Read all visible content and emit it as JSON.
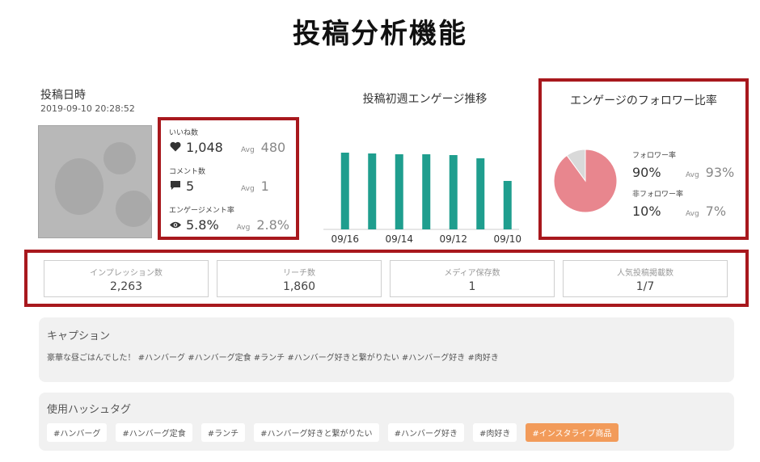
{
  "page": {
    "title": "投稿分析機能"
  },
  "post": {
    "date_label": "投稿日時",
    "date": "2019-09-10 20:28:52"
  },
  "stats": [
    {
      "label": "いいね数",
      "icon": "heart-icon",
      "value": "1,048",
      "avg_label": "Avg",
      "avg_value": "480"
    },
    {
      "label": "コメント数",
      "icon": "comment-icon",
      "value": "5",
      "avg_label": "Avg",
      "avg_value": "1"
    },
    {
      "label": "エンゲージメント率",
      "icon": "eye-icon",
      "value": "5.8%",
      "avg_label": "Avg",
      "avg_value": "2.8%"
    }
  ],
  "chart_data": [
    {
      "type": "bar",
      "title": "投稿初週エンゲージ推移",
      "categories": [
        "09/16",
        "",
        "09/14",
        "",
        "09/12",
        "",
        "09/10"
      ],
      "values": [
        95,
        94,
        93,
        93,
        92,
        88,
        60
      ],
      "ylim": [
        0,
        100
      ],
      "color": "#1f9e8e",
      "grid": false
    },
    {
      "type": "pie",
      "title": "エンゲージのフォロワー比率",
      "labels": [
        "フォロワー率",
        "非フォロワー率"
      ],
      "values": [
        90,
        10
      ],
      "avg_label": "Avg",
      "avg_values": [
        "93%",
        "7%"
      ],
      "display_values": [
        "90%",
        "10%"
      ],
      "colors": [
        "#e8868e",
        "#d9d9d9"
      ]
    }
  ],
  "metrics": [
    {
      "label": "インプレッション数",
      "value": "2,263"
    },
    {
      "label": "リーチ数",
      "value": "1,860"
    },
    {
      "label": "メディア保存数",
      "value": "1"
    },
    {
      "label": "人気投稿掲載数",
      "value": "1/7"
    }
  ],
  "caption": {
    "title": "キャプション",
    "text": "豪華な昼ごはんでした！ #ハンバーグ #ハンバーグ定食 #ランチ #ハンバーグ好きと繋がりたい #ハンバーグ好き #肉好き"
  },
  "hashtags": {
    "title": "使用ハッシュタグ",
    "tags": [
      "#ハンバーグ",
      "#ハンバーグ定食",
      "#ランチ",
      "#ハンバーグ好きと繋がりたい",
      "#ハンバーグ好き",
      "#肉好き",
      "#インスタライブ商品"
    ],
    "highlight_color": "#f29b5a"
  }
}
